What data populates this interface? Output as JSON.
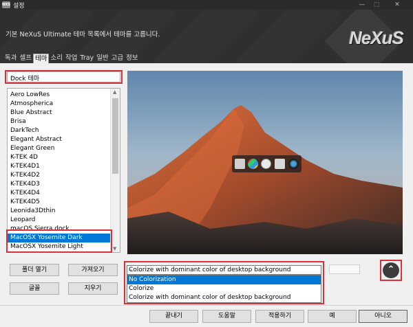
{
  "window": {
    "title": "설정",
    "app_icon_text": "NXS",
    "controls": {
      "minimize": "—",
      "maximize": "□",
      "close": "✕"
    }
  },
  "banner": {
    "description": "기본 NeXuS Ultimate 테마 목록에서 테마를 고릅니다.",
    "logo": "NeXuS"
  },
  "tabs": [
    {
      "label": "독과",
      "active": false
    },
    {
      "label": "셀프",
      "active": false
    },
    {
      "label": "테마",
      "active": true
    },
    {
      "label": "소리",
      "active": false
    },
    {
      "label": "작업",
      "active": false
    },
    {
      "label": "Tray",
      "active": false
    },
    {
      "label": "일반",
      "active": false
    },
    {
      "label": "고급",
      "active": false
    },
    {
      "label": "정보",
      "active": false
    }
  ],
  "theme_type": {
    "selected": "Dock 테마",
    "arrow": "⌄"
  },
  "theme_list": {
    "items": [
      "Aero LowRes",
      "Atmospherica",
      "Blue Abstract",
      "Brisa",
      "DarkTech",
      "Elegant Abstract",
      "Elegant Green",
      "K-TEK 4D",
      "K-TEK4D1",
      "K-TEK4D2",
      "K-TEK4D3",
      "K-TEK4D4",
      "K-TEK4D5",
      "Leonida3Dthin",
      "Leopard",
      "macOS Sierra dock",
      "MacOSX Yosemite Dark",
      "MacOSX Yosemite Light"
    ],
    "selected_index": 16,
    "scroll_up": "▲",
    "scroll_down": "▼"
  },
  "left_buttons": {
    "open_folder": "폴더 열기",
    "import": "가져오기",
    "font": "글꼴",
    "delete": "지우기"
  },
  "preview": {
    "dock_icons": [
      "nexus-icon",
      "windows-icon",
      "clock-icon",
      "recycle-bin-icon",
      "camera-icon"
    ]
  },
  "colorize": {
    "selected": "Colorize with dominant color of desktop background",
    "arrow": "⌄",
    "options": [
      "No Colorization",
      "Colorize",
      "Colorize with dominant color of desktop background"
    ],
    "highlighted_index": 0
  },
  "up_button": {
    "glyph": "⌃"
  },
  "bottom_buttons": {
    "apply_close": "끝내기",
    "help": "도움말",
    "apply": "적용하기",
    "yes": "예",
    "no": "아니오"
  },
  "colors": {
    "highlight_red": "#d9303a",
    "selection_blue": "#0078d7",
    "banner_dark": "#2f2f2f"
  }
}
